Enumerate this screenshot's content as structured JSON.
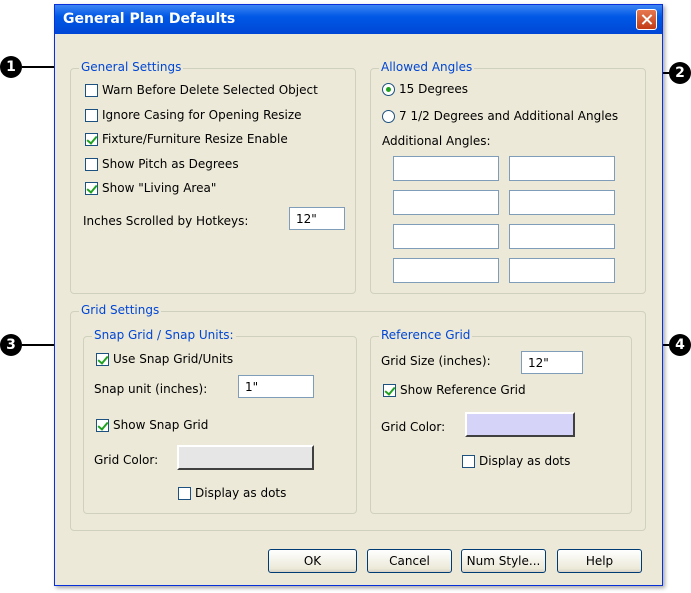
{
  "dialog": {
    "title": "General Plan Defaults"
  },
  "general": {
    "legend": "General Settings",
    "checks": [
      {
        "label": "Warn Before Delete Selected Object",
        "checked": false
      },
      {
        "label": "Ignore Casing for Opening Resize",
        "checked": false
      },
      {
        "label": "Fixture/Furniture Resize Enable",
        "checked": true
      },
      {
        "label": "Show Pitch as Degrees",
        "checked": false
      },
      {
        "label": "Show \"Living Area\"",
        "checked": true
      }
    ],
    "hotkeys_label": "Inches Scrolled by Hotkeys:",
    "hotkeys_value": "12\""
  },
  "angles": {
    "legend": "Allowed Angles",
    "options": [
      {
        "label": "15 Degrees",
        "selected": true
      },
      {
        "label": "7 1/2 Degrees and Additional Angles",
        "selected": false
      }
    ],
    "additional_label": "Additional Angles:"
  },
  "grid": {
    "legend": "Grid Settings",
    "snap": {
      "legend": "Snap Grid / Snap Units:",
      "use_snap": {
        "label": "Use Snap Grid/Units",
        "checked": true
      },
      "unit_label": "Snap unit (inches):",
      "unit_value": "1\"",
      "show_snap": {
        "label": "Show Snap Grid",
        "checked": true
      },
      "color_label": "Grid Color:",
      "color": "#e6e6e6",
      "dots": {
        "label": "Display as dots",
        "checked": false
      }
    },
    "reference": {
      "legend": "Reference Grid",
      "size_label": "Grid Size (inches):",
      "size_value": "12\"",
      "show_ref": {
        "label": "Show Reference Grid",
        "checked": true
      },
      "color_label": "Grid Color:",
      "color": "#d6d3f8",
      "dots": {
        "label": "Display as dots",
        "checked": false
      }
    }
  },
  "buttons": {
    "ok": "OK",
    "cancel": "Cancel",
    "num_style": "Num Style...",
    "help": "Help"
  },
  "callouts": [
    "1",
    "2",
    "3",
    "4"
  ]
}
